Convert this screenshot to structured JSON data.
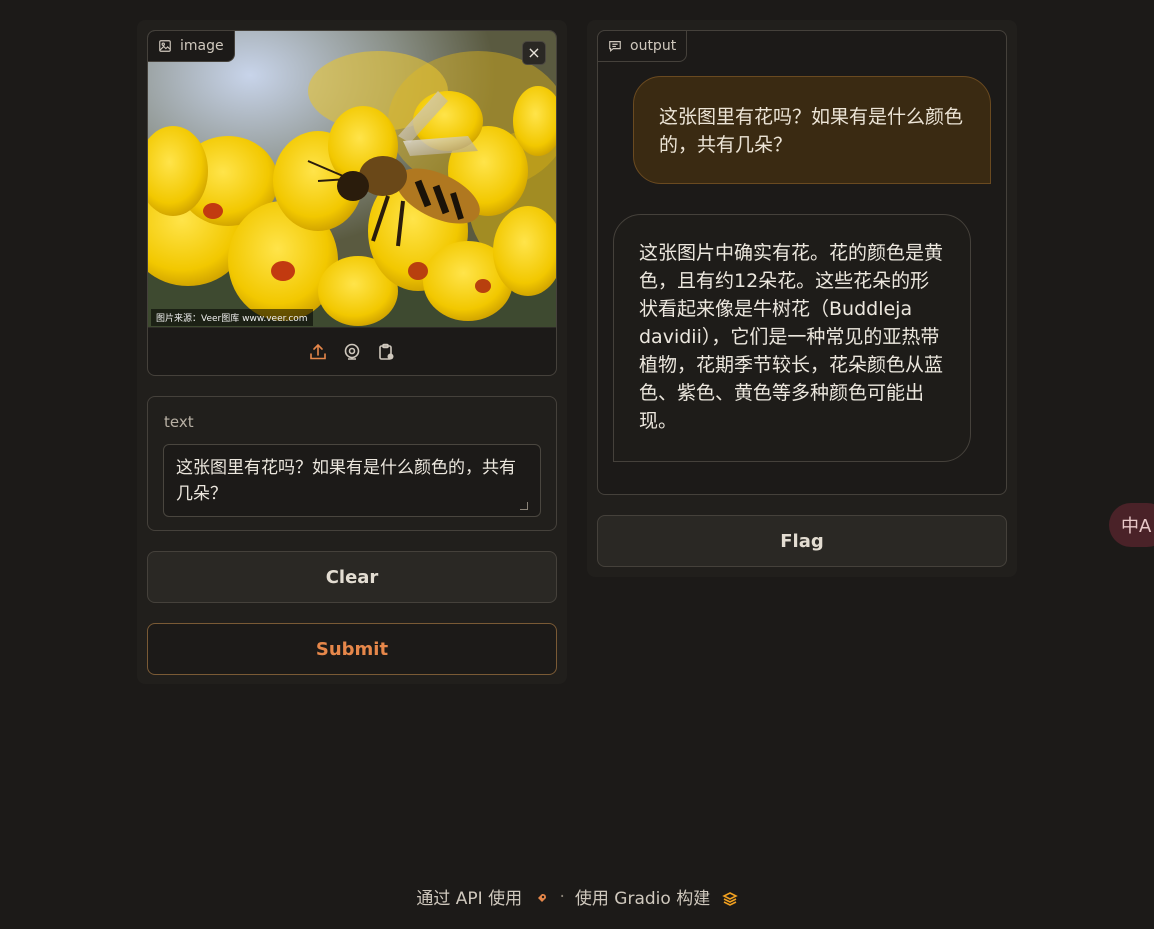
{
  "image_input": {
    "label": "image",
    "watermark": "图片来源：Veer图库 www.veer.com",
    "close_symbol": "×",
    "sources": [
      "upload-icon",
      "webcam-icon",
      "clipboard-icon"
    ]
  },
  "text_input": {
    "label": "text",
    "value": "这张图里有花吗？如果有是什么颜色的，共有几朵？"
  },
  "buttons": {
    "clear": "Clear",
    "submit": "Submit",
    "flag": "Flag"
  },
  "output": {
    "label": "output",
    "messages": [
      {
        "role": "user",
        "text": "这张图里有花吗？如果有是什么颜色的，共有几朵？"
      },
      {
        "role": "assistant",
        "text": "这张图片中确实有花。花的颜色是黄色，且有约12朵花。这些花朵的形状看起来像是牛树花（Buddleja davidii），它们是一种常见的亚热带植物，花期季节较长，花朵颜色从蓝色、紫色、黄色等多种颜色可能出现。"
      }
    ]
  },
  "translate_button": {
    "icon": "translate-icon",
    "glyph": "中A"
  },
  "footer": {
    "api_link": "通过 API 使用",
    "separator": "·",
    "built_with": "使用 Gradio 构建"
  },
  "colors": {
    "background": "#1c1a18",
    "accent": "#e6874a",
    "user_bubble": "#3a2a12"
  }
}
